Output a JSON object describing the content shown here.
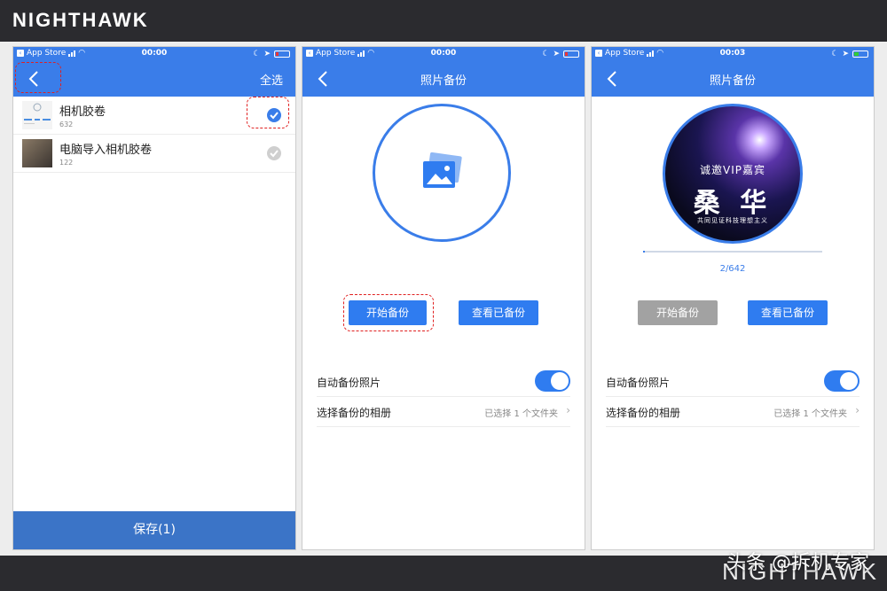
{
  "brand": {
    "top": "NIGHTHAWK",
    "bottom": "NIGHTHAWK"
  },
  "watermark": "头条 @拆机专家",
  "colors": {
    "accent": "#3a7de9",
    "button": "#2f7cf0",
    "save_bar": "#3b74c7",
    "disabled": "#a2a2a2",
    "highlight": "#e02020"
  },
  "screen1": {
    "status": {
      "carrier": "App Store",
      "time": "00:00"
    },
    "nav": {
      "back_icon": "chevron-left-icon",
      "select_all": "全选"
    },
    "albums": [
      {
        "name": "相机胶卷",
        "count": "632",
        "checked": true
      },
      {
        "name": "电脑导入相机胶卷",
        "count": "122",
        "checked": false
      }
    ],
    "save_label": "保存(1)"
  },
  "screen2": {
    "status": {
      "carrier": "App Store",
      "time": "00:00"
    },
    "title": "照片备份",
    "center_icon": "photo-icon",
    "start_backup": "开始备份",
    "view_backup": "查看已备份",
    "auto_backup_label": "自动备份照片",
    "auto_backup_on": true,
    "select_album_label": "选择备份的相册",
    "select_album_value": "已选择 1 个文件夹"
  },
  "screen3": {
    "status": {
      "carrier": "App Store",
      "time": "00:03"
    },
    "title": "照片备份",
    "vip": {
      "line1": "诚邀VIP嘉宾",
      "line2": "桑 华",
      "line3": "共同见证科技理想主义"
    },
    "progress_text": "2/642",
    "progress_fraction": 0.003,
    "start_backup": "开始备份",
    "view_backup": "查看已备份",
    "auto_backup_label": "自动备份照片",
    "auto_backup_on": true,
    "select_album_label": "选择备份的相册",
    "select_album_value": "已选择 1 个文件夹"
  }
}
